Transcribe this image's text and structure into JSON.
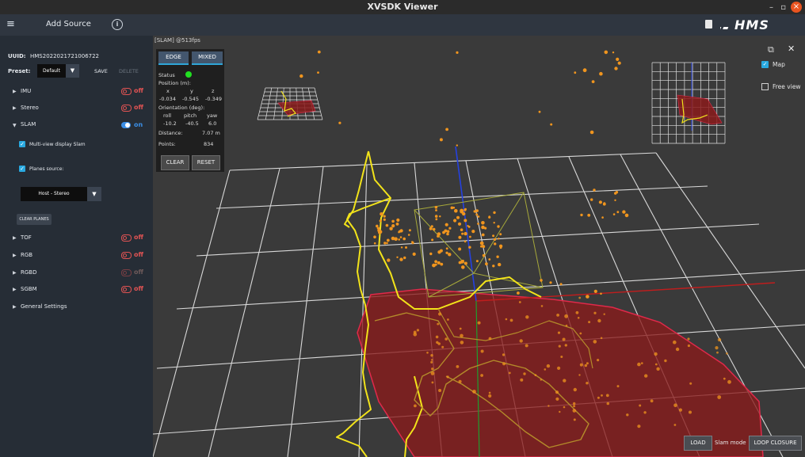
{
  "window": {
    "title": "XVSDK Viewer",
    "min_label": "–",
    "max_label": "▫",
    "close_label": "×"
  },
  "toolbar": {
    "menu_icon": "≡",
    "add_source": "Add Source",
    "info_icon": "i",
    "logo": "HMS"
  },
  "sidebar": {
    "uuid_label": "UUID:",
    "uuid_value": "HMS2022021721006722",
    "preset_label": "Preset:",
    "preset_value": "Default",
    "preset_arrow": "▼",
    "save_label": "SAVE",
    "delete_label": "DELETE",
    "sections": [
      {
        "label": "IMU",
        "state": "off",
        "caret": "▶"
      },
      {
        "label": "Stereo",
        "state": "off",
        "caret": "▶"
      },
      {
        "label": "SLAM",
        "state": "on",
        "caret": "▼"
      },
      {
        "label": "TOF",
        "state": "off",
        "caret": "▶"
      },
      {
        "label": "RGB",
        "state": "off",
        "caret": "▶"
      },
      {
        "label": "RGBD",
        "state": "off",
        "caret": "▶"
      },
      {
        "label": "SGBM",
        "state": "off",
        "caret": "▶"
      },
      {
        "label": "General Settings",
        "caret": "▶"
      }
    ],
    "slam": {
      "multiview_label": "Multi-view display Slam",
      "planes_label": "Planes source:",
      "planes_value": "Host - Stereo",
      "planes_arrow": "▼",
      "clear_planes": "CLEAR PLANES",
      "check_mark": "✓"
    }
  },
  "viewport": {
    "title": "[SLAM] @513fps",
    "panel": {
      "tab_edge": "EDGE",
      "tab_mixed": "MIXED",
      "status_label": "Status",
      "status_color": "#21e021",
      "position_label": "Position (m):",
      "pos_headers": [
        "x",
        "y",
        "z"
      ],
      "pos_values": [
        "-0.034",
        "-0.545",
        "-0.349"
      ],
      "orientation_label": "Orientation (deg):",
      "ori_headers": [
        "roll",
        "pitch",
        "yaw"
      ],
      "ori_values": [
        "-10.2",
        "-40.5",
        "6.0"
      ],
      "distance_label": "Distance:",
      "distance_value": "7.07 m",
      "points_label": "Points:",
      "points_value": "834",
      "clear_button": "CLEAR",
      "reset_button": "RESET"
    },
    "right": {
      "map_label": "Map",
      "freeview_label": "Free view",
      "check_mark": "✓",
      "popout_icon": "⧉",
      "close_icon": "✕"
    },
    "bottom": {
      "load_button": "LOAD",
      "slam_mode_label": "Slam mode",
      "loop_closure_button": "LOOP CLOSURE"
    }
  },
  "colors": {
    "accent": "#29a9e0",
    "off": "#e05353",
    "on": "#3a8ee6",
    "trajectory": "#f2e31a",
    "points": "#f0951e",
    "plane": "#8a1b1b"
  }
}
